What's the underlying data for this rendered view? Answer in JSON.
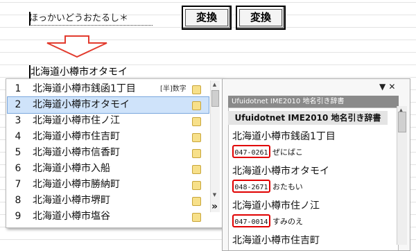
{
  "input": {
    "reading": "ほっかいどうおたるし＊"
  },
  "buttons": {
    "convert_1": "変換",
    "convert_2": "変換"
  },
  "composing_text": "北海道小樽市オタモイ",
  "candidates": {
    "hint": "[半]数字",
    "selected_index": 1,
    "items": [
      {
        "num": "1",
        "text": "北海道小樽市銭函1丁目"
      },
      {
        "num": "2",
        "text": "北海道小樽市オタモイ"
      },
      {
        "num": "3",
        "text": "北海道小樽市住ノ江"
      },
      {
        "num": "4",
        "text": "北海道小樽市住吉町"
      },
      {
        "num": "5",
        "text": "北海道小樽市信香町"
      },
      {
        "num": "6",
        "text": "北海道小樽市入船"
      },
      {
        "num": "7",
        "text": "北海道小樽市勝納町"
      },
      {
        "num": "8",
        "text": "北海道小樽市堺町"
      },
      {
        "num": "9",
        "text": "北海道小樽市塩谷"
      }
    ],
    "expand_icon": "double-chevron-right-icon",
    "expand_symbol": "»"
  },
  "dictionary": {
    "title": "Ufuidotnet IME2010 地名引き辞書",
    "section": "Ufuidotnet IME2010 地名引き辞書",
    "controls": "▼ ✕",
    "entries": [
      {
        "name": "北海道小樽市銭函1丁目",
        "postal": "047-0261",
        "kana": "ぜにばこ"
      },
      {
        "name": "北海道小樽市オタモイ",
        "postal": "048-2671",
        "kana": "おたもい"
      },
      {
        "name": "北海道小樽市住ノ江",
        "postal": "047-0014",
        "kana": "すみのえ"
      },
      {
        "name": "北海道小樽市住吉町",
        "postal": "",
        "kana": ""
      }
    ]
  },
  "colors": {
    "highlight": "#cfe3fa",
    "postal_border": "#e00000",
    "header_gray": "#8a8a8a"
  }
}
